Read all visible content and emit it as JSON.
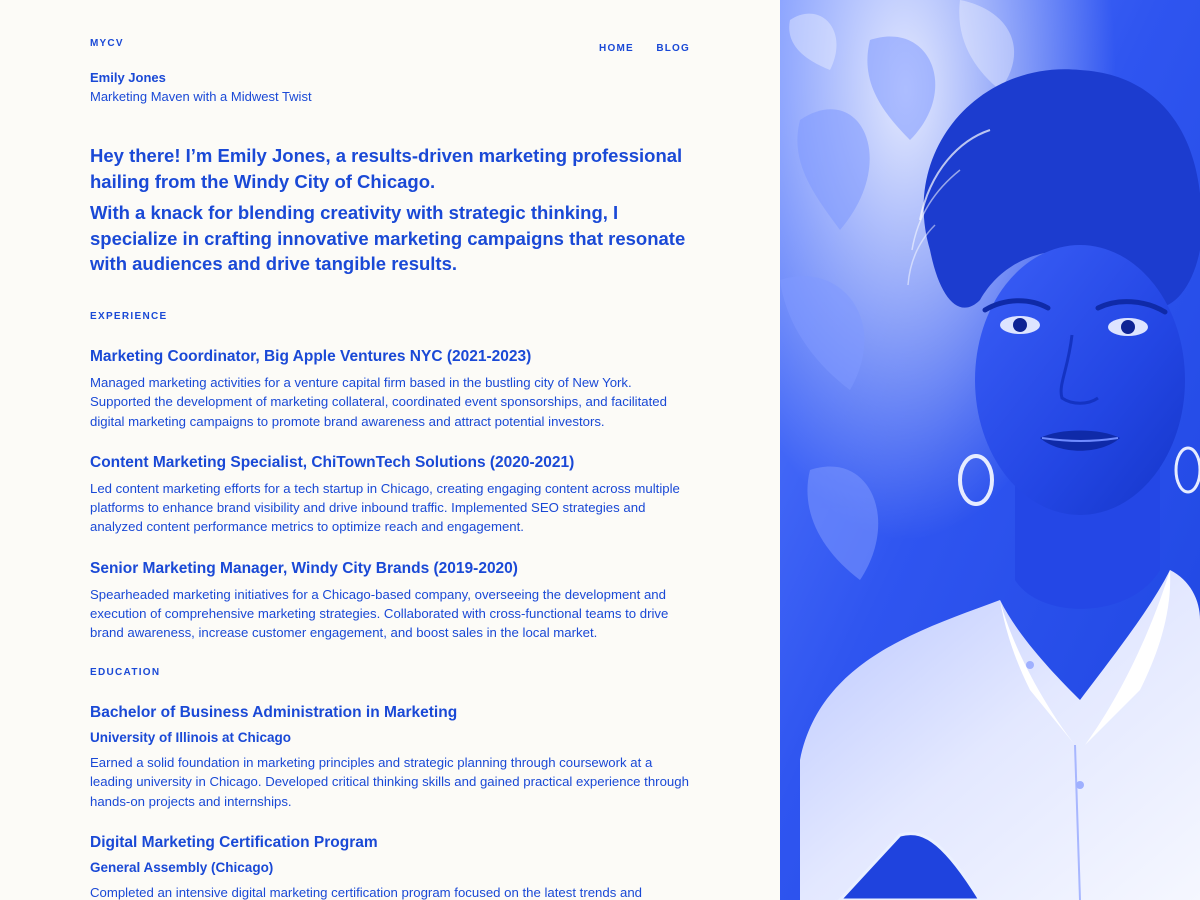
{
  "nav": {
    "brand": "MYCV",
    "links": [
      "HOME",
      "BLOG"
    ]
  },
  "header": {
    "name": "Emily Jones",
    "tagline": "Marketing Maven with a Midwest Twist"
  },
  "intro": [
    "Hey there! I’m Emily Jones, a results-driven marketing professional hailing from the Windy City of Chicago.",
    "With a knack for blending creativity with strategic thinking, I specialize in crafting innovative marketing campaigns that resonate with audiences and drive tangible results."
  ],
  "experience": {
    "label": "EXPERIENCE",
    "items": [
      {
        "title": "Marketing Coordinator, Big Apple Ventures NYC (2021-2023)",
        "description": "Managed marketing activities for a venture capital firm based in the bustling city of New York. Supported the development of marketing collateral, coordinated event sponsorships, and facilitated digital marketing campaigns to promote brand awareness and attract potential investors."
      },
      {
        "title": "Content Marketing Specialist, ChiTownTech Solutions (2020-2021)",
        "description": "Led content marketing efforts for a tech startup in Chicago, creating engaging content across multiple platforms to enhance brand visibility and drive inbound traffic. Implemented SEO strategies and analyzed content performance metrics to optimize reach and engagement."
      },
      {
        "title": "Senior Marketing Manager, Windy City Brands (2019-2020)",
        "description": "Spearheaded marketing initiatives for a Chicago-based company, overseeing the development and execution of comprehensive marketing strategies. Collaborated with cross-functional teams to drive brand awareness, increase customer engagement, and boost sales in the local market."
      }
    ]
  },
  "education": {
    "label": "EDUCATION",
    "items": [
      {
        "title": "Bachelor of Business Administration in Marketing",
        "school": "University of Illinois at Chicago",
        "description": "Earned a solid foundation in marketing principles and strategic planning through coursework at a leading university in Chicago. Developed critical thinking skills and gained practical experience through hands-on projects and internships."
      },
      {
        "title": "Digital Marketing Certification Program",
        "school": "General Assembly (Chicago)",
        "description": "Completed an intensive digital marketing certification program focused on the latest trends and"
      }
    ]
  },
  "colors": {
    "accent": "#1a49d6",
    "background": "#fcfbf7",
    "photo_tint": "#3f66ff"
  },
  "photo": {
    "icon": "portrait-photo"
  }
}
